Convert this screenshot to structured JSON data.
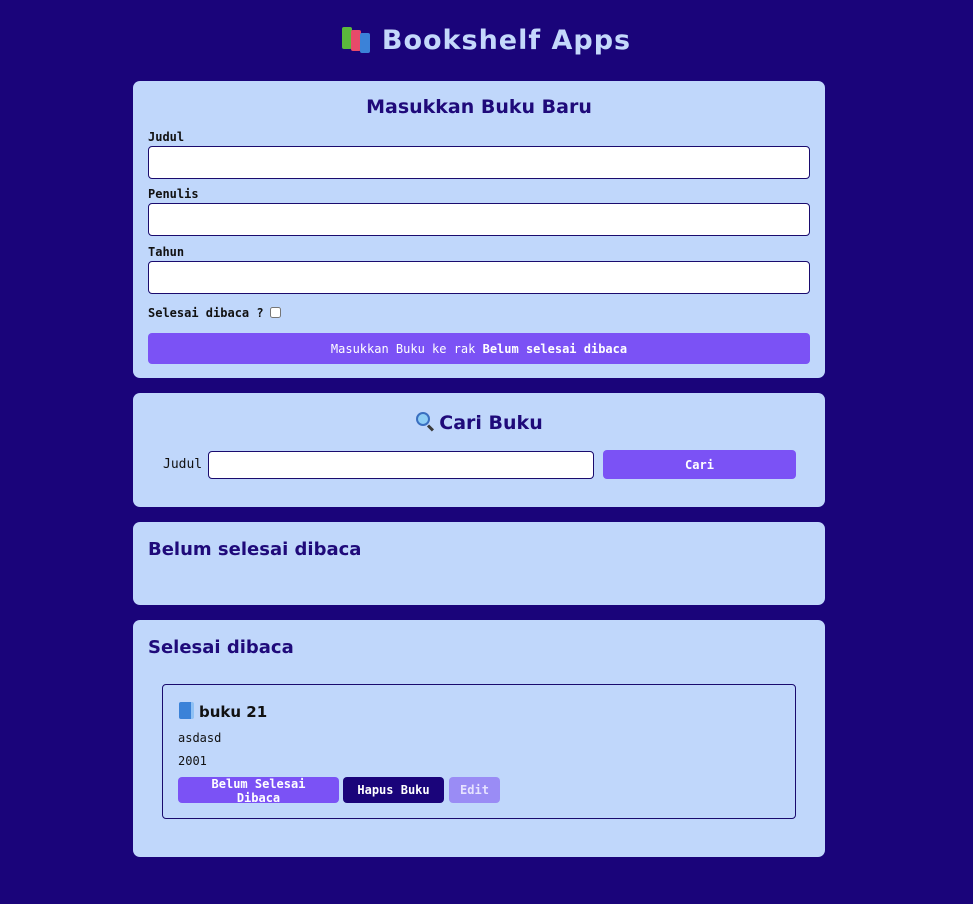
{
  "header": {
    "title": "Bookshelf Apps",
    "logo_icon": "books-icon"
  },
  "form": {
    "title": "Masukkan Buku Baru",
    "judul_label": "Judul",
    "judul_value": "",
    "penulis_label": "Penulis",
    "penulis_value": "",
    "tahun_label": "Tahun",
    "tahun_value": "",
    "complete_label": "Selesai dibaca ?",
    "complete_checked": false,
    "submit_prefix": "Masukkan Buku ke rak ",
    "submit_shelf": "Belum selesai dibaca"
  },
  "search": {
    "title_icon": "magnifier-icon",
    "title": "Cari Buku",
    "label": "Judul",
    "value": "",
    "button": "Cari"
  },
  "shelves": {
    "incomplete_title": "Belum selesai dibaca",
    "complete_title": "Selesai dibaca"
  },
  "complete_books": [
    {
      "icon": "blue-book-icon",
      "title": "buku 21",
      "author": "asdasd",
      "year": "2001",
      "move_button": "Belum Selesai Dibaca",
      "delete_button": "Hapus Buku",
      "edit_button": "Edit"
    }
  ],
  "colors": {
    "background": "#1a047a",
    "card": "#c0d7fb",
    "accent": "#7b52f5",
    "dark_button": "#1a047a",
    "edit_button": "#9a8cf5"
  }
}
